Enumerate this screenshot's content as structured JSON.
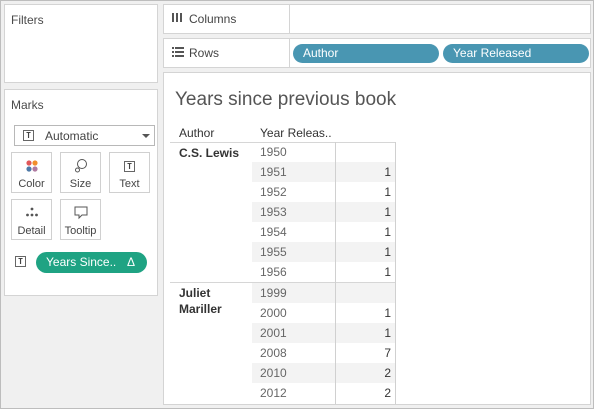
{
  "left_panel": {
    "filters_title": "Filters",
    "marks_title": "Marks",
    "mark_type": "Automatic",
    "buttons": [
      {
        "label": "Color",
        "icon": "color-icon"
      },
      {
        "label": "Size",
        "icon": "size-icon"
      },
      {
        "label": "Text",
        "icon": "text-icon"
      },
      {
        "label": "Detail",
        "icon": "detail-icon"
      },
      {
        "label": "Tooltip",
        "icon": "tooltip-icon"
      }
    ],
    "text_pill": {
      "label": "Years Since..",
      "delta": "Δ",
      "color": "#1fa383"
    }
  },
  "columns_shelf": {
    "label": "Columns",
    "icon": "columns-icon"
  },
  "rows_shelf": {
    "label": "Rows",
    "icon": "rows-icon",
    "pills": [
      {
        "label": "Author",
        "color": "#4996b2"
      },
      {
        "label": "Year Released",
        "color": "#4996b2"
      }
    ]
  },
  "view": {
    "title": "Years since previous book",
    "headers": [
      "Author",
      "Year Releas.."
    ],
    "groups": [
      {
        "author": "C.S. Lewis",
        "rows": [
          {
            "year": "1950",
            "value": ""
          },
          {
            "year": "1951",
            "value": "1"
          },
          {
            "year": "1952",
            "value": "1"
          },
          {
            "year": "1953",
            "value": "1"
          },
          {
            "year": "1954",
            "value": "1"
          },
          {
            "year": "1955",
            "value": "1"
          },
          {
            "year": "1956",
            "value": "1"
          }
        ]
      },
      {
        "author": "Juliet Mariller",
        "rows": [
          {
            "year": "1999",
            "value": ""
          },
          {
            "year": "2000",
            "value": "1"
          },
          {
            "year": "2001",
            "value": "1"
          },
          {
            "year": "2008",
            "value": "7"
          },
          {
            "year": "2010",
            "value": "2"
          },
          {
            "year": "2012",
            "value": "2"
          }
        ]
      }
    ]
  }
}
